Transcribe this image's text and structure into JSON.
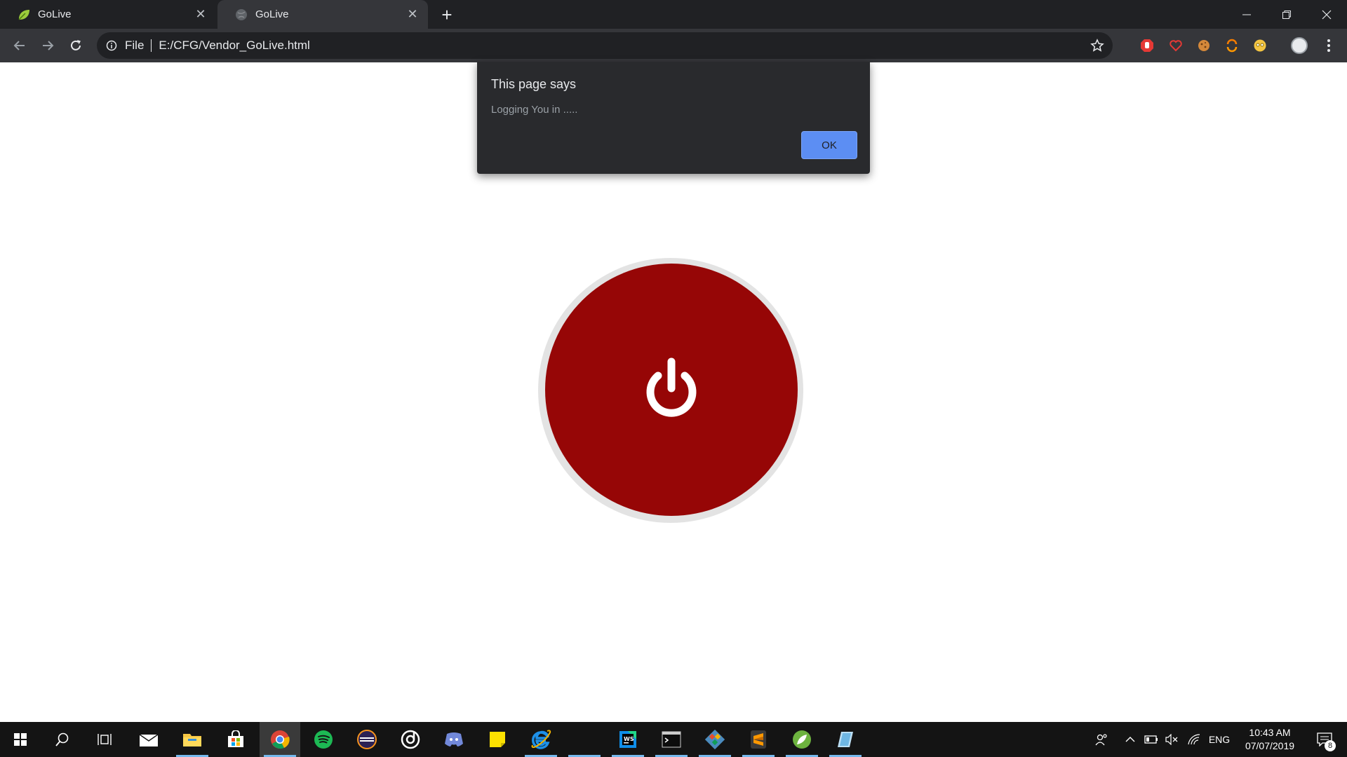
{
  "browser": {
    "tabs": [
      {
        "title": "GoLive",
        "favicon": "leaf-icon",
        "active": false
      },
      {
        "title": "GoLive",
        "favicon": "globe-icon",
        "active": true
      }
    ],
    "address": {
      "scheme": "File",
      "url": "E:/CFG/Vendor_GoLive.html"
    },
    "extensions": [
      "stop-hand-icon",
      "heart-icon",
      "cookie-icon",
      "refresh-orange-icon",
      "face-icon"
    ]
  },
  "dialog": {
    "title": "This page says",
    "message": "Logging You in .....",
    "ok_label": "OK"
  },
  "page": {
    "power_button_color": "#960606"
  },
  "taskbar": {
    "apps": [
      "start",
      "search",
      "task-view",
      "mail",
      "file-explorer",
      "store",
      "chrome",
      "spotify",
      "eclipse",
      "music-app",
      "discord",
      "sticky-notes",
      "internet-explorer",
      "webstorm",
      "terminal",
      "git",
      "sublime-text",
      "spring-tool-suite",
      "file-manager"
    ],
    "language": "ENG",
    "time": "10:43 AM",
    "date": "07/07/2019",
    "notifications": "8"
  }
}
